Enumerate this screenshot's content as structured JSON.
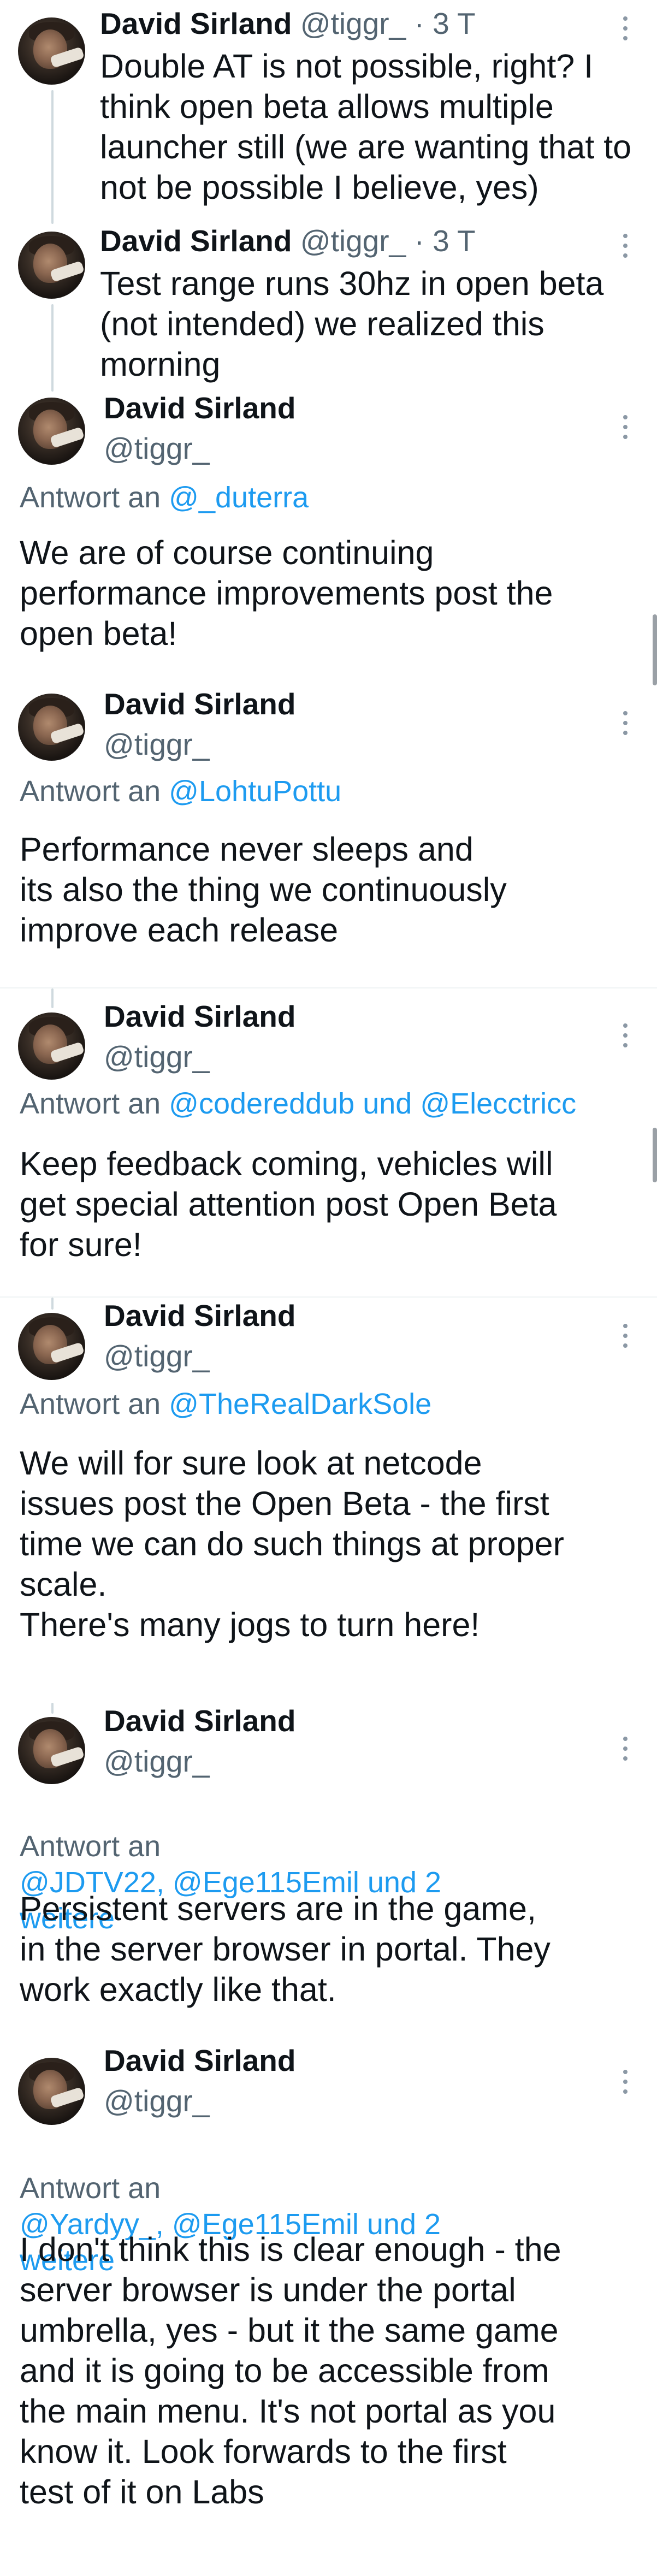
{
  "tweets": [
    {
      "name": "David Sirland",
      "handle": "@tiggr_",
      "sep": "·",
      "time": "3 T",
      "text": "Double AT is not possible, right? I\nthink open beta allows multiple\nlauncher still (we are wanting that to\nnot be possible I believe, yes)"
    },
    {
      "name": "David Sirland",
      "handle": "@tiggr_",
      "sep": "·",
      "time": "3 T",
      "text": "Test range runs 30hz in open beta\n(not intended) we realized this\nmorning"
    },
    {
      "name": "David Sirland",
      "handle": "@tiggr_",
      "reply_prefix": "Antwort an",
      "reply_mentions": "@_duterra",
      "text": "We are of course continuing\nperformance improvements post the\nopen beta!"
    },
    {
      "name": "David Sirland",
      "handle": "@tiggr_",
      "reply_prefix": "Antwort an",
      "reply_mentions": "@LohtuPottu",
      "text": "Performance never sleeps and\nits also the thing we continuously\nimprove each release"
    },
    {
      "name": "David Sirland",
      "handle": "@tiggr_",
      "reply_prefix": "Antwort an",
      "reply_mentions": "@codereddub und @Elecctricc",
      "text": "Keep feedback coming, vehicles will\nget special attention post Open Beta\nfor sure!"
    },
    {
      "name": "David Sirland",
      "handle": "@tiggr_",
      "reply_prefix": "Antwort an",
      "reply_mentions": "@TheRealDarkSole",
      "text": "We will for sure look at netcode\nissues post the Open Beta - the first\ntime we can do such things at proper\nscale.\nThere's many jogs to turn here!"
    },
    {
      "name": "David Sirland",
      "handle": "@tiggr_",
      "reply_prefix": "Antwort an",
      "reply_mentions": "@JDTV22, @Ege115Emil und 2\nweitere",
      "text": "Persistent servers are in the game,\nin the server browser in portal. They\nwork exactly like that."
    },
    {
      "name": "David Sirland",
      "handle": "@tiggr_",
      "reply_prefix": "Antwort an",
      "reply_mentions": "@Yardyy_, @Ege115Emil und 2\nweitere",
      "text": "I don't think this is clear enough - the\nserver browser is under the portal\numbrella, yes - but it the same game\nand it is going to be accessible from\nthe main menu. It's not portal as you\nknow it. Look forwards to the first\ntest of it on Labs"
    }
  ]
}
